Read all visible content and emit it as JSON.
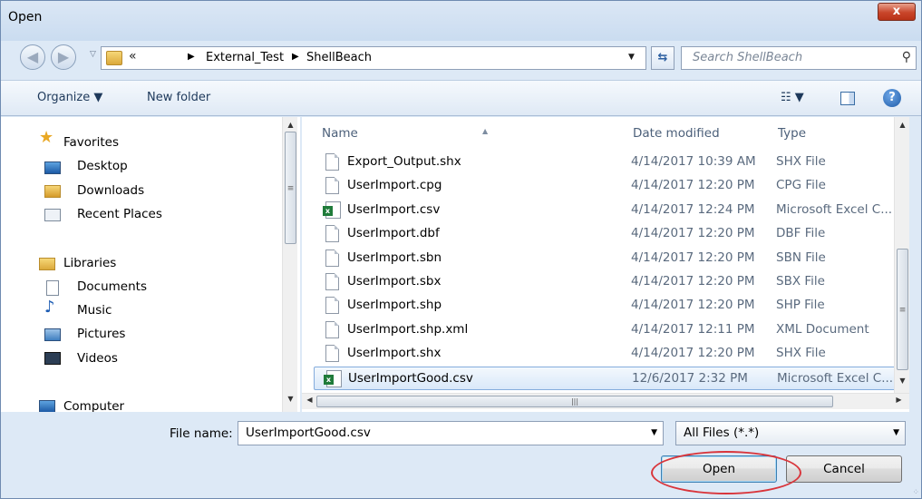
{
  "window": {
    "title": "Open",
    "close_label": "x"
  },
  "nav": {
    "back_glyph": "◀",
    "forward_glyph": "▶",
    "breadcrumb": {
      "overflow": "«",
      "items": [
        "External_Test",
        "ShellBeach"
      ]
    },
    "search_placeholder": "Search ShellBeach"
  },
  "toolbar": {
    "organize_label": "Organize ▼",
    "new_folder_label": "New folder",
    "views_label": "☷ ▼",
    "help_label": "?"
  },
  "navpane": {
    "favorites": {
      "label": "Favorites",
      "items": [
        "Desktop",
        "Downloads",
        "Recent Places"
      ]
    },
    "libraries": {
      "label": "Libraries",
      "items": [
        "Documents",
        "Music",
        "Pictures",
        "Videos"
      ]
    },
    "computer": {
      "label": "Computer"
    }
  },
  "filelist": {
    "columns": {
      "name": "Name",
      "date": "Date modified",
      "type": "Type"
    },
    "rows": [
      {
        "name": "Export_Output.shx",
        "date": "4/14/2017 10:39 AM",
        "type": "SHX File",
        "icon": "generic-file-icon"
      },
      {
        "name": "UserImport.cpg",
        "date": "4/14/2017 12:20 PM",
        "type": "CPG File",
        "icon": "generic-file-icon"
      },
      {
        "name": "UserImport.csv",
        "date": "4/14/2017 12:24 PM",
        "type": "Microsoft Excel C...",
        "icon": "excel-file-icon"
      },
      {
        "name": "UserImport.dbf",
        "date": "4/14/2017 12:20 PM",
        "type": "DBF File",
        "icon": "generic-file-icon"
      },
      {
        "name": "UserImport.sbn",
        "date": "4/14/2017 12:20 PM",
        "type": "SBN File",
        "icon": "generic-file-icon"
      },
      {
        "name": "UserImport.sbx",
        "date": "4/14/2017 12:20 PM",
        "type": "SBX File",
        "icon": "generic-file-icon"
      },
      {
        "name": "UserImport.shp",
        "date": "4/14/2017 12:20 PM",
        "type": "SHP File",
        "icon": "generic-file-icon"
      },
      {
        "name": "UserImport.shp.xml",
        "date": "4/14/2017 12:11 PM",
        "type": "XML Document",
        "icon": "generic-file-icon"
      },
      {
        "name": "UserImport.shx",
        "date": "4/14/2017 12:20 PM",
        "type": "SHX File",
        "icon": "generic-file-icon"
      },
      {
        "name": "UserImportGood.csv",
        "date": "12/6/2017 2:32 PM",
        "type": "Microsoft Excel C...",
        "icon": "excel-file-icon",
        "selected": true
      }
    ]
  },
  "footer": {
    "file_name_label": "File name:",
    "file_name_value": "UserImportGood.csv",
    "filter_value": "All Files (*.*)",
    "open_label": "Open",
    "cancel_label": "Cancel"
  },
  "colors": {
    "accent": "#3c7fb1",
    "highlight_ring": "#d9353b",
    "close_button": "#c9452a",
    "selection": "#d9e8f9"
  }
}
